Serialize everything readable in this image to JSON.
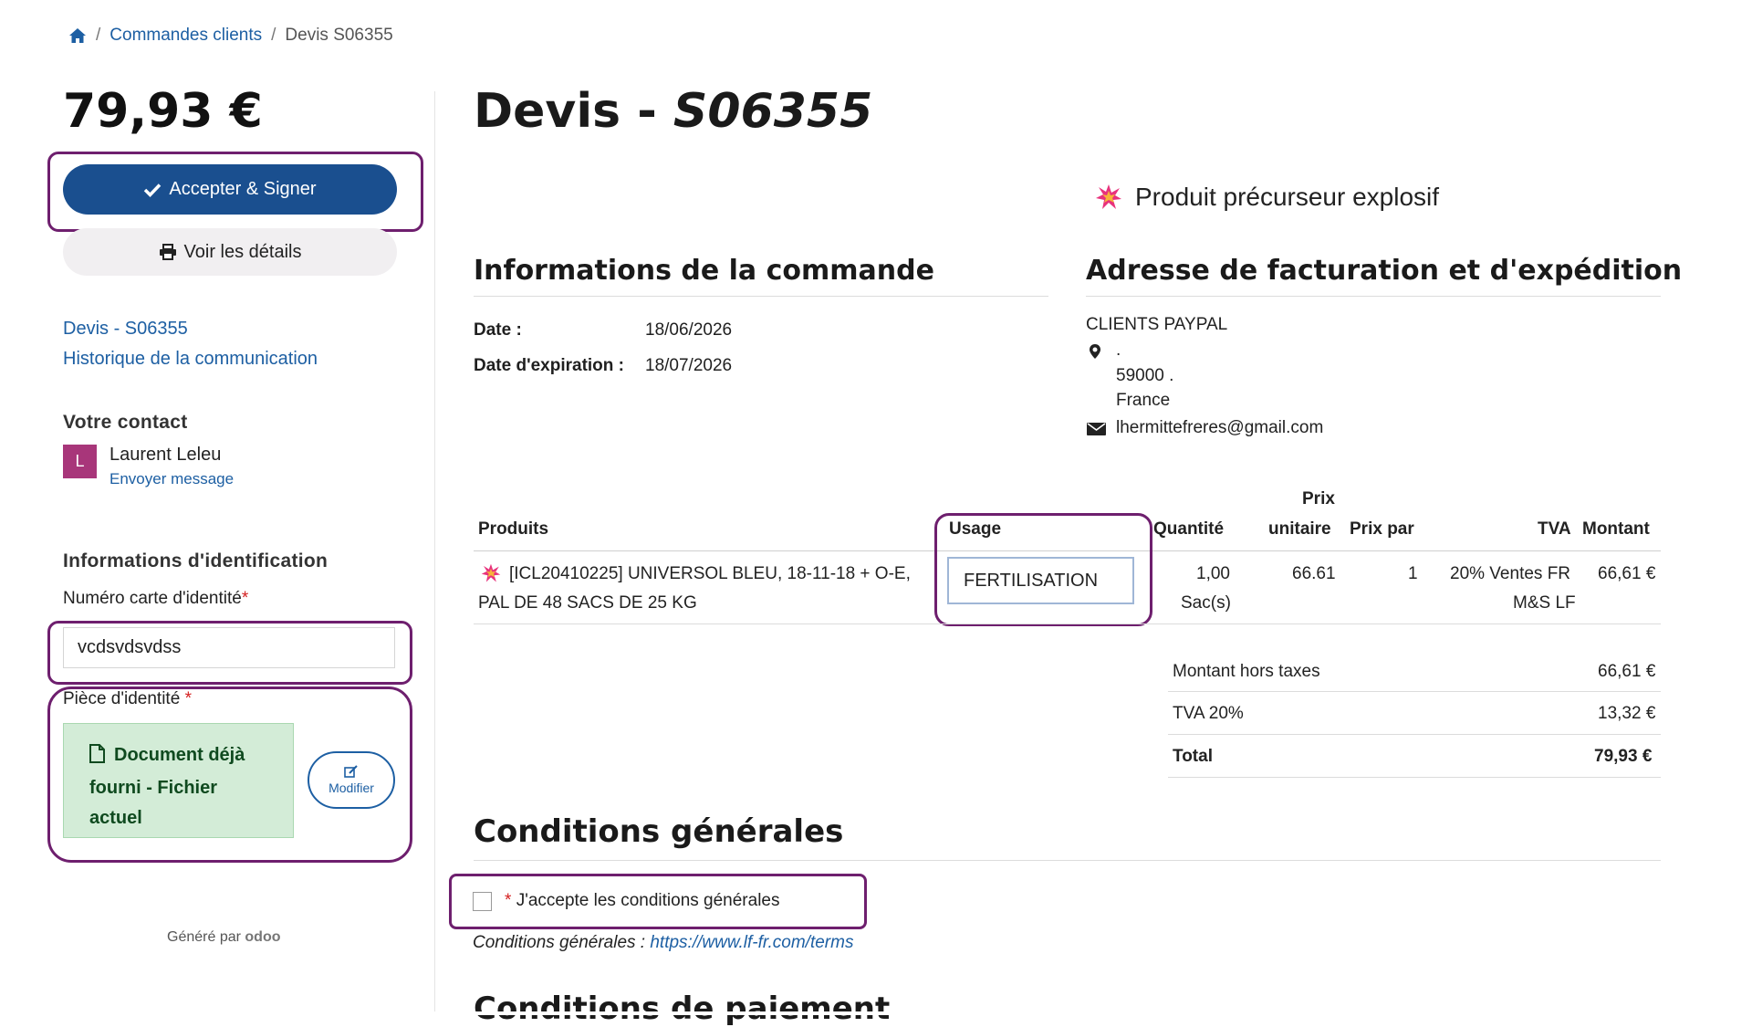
{
  "breadcrumb": {
    "home_icon": "home-icon",
    "sep1": "/",
    "orders": "Commandes clients",
    "sep2": "/",
    "current": "Devis S06355"
  },
  "sidebar": {
    "total": "79,93 €",
    "accept_label": "Accepter & Signer",
    "details_label": "Voir les détails",
    "links": [
      "Devis - S06355",
      "Historique de la communication"
    ],
    "contact_title": "Votre contact",
    "contact_initial": "L",
    "contact_name": "Laurent Leleu",
    "contact_message": "Envoyer message",
    "id_section_title": "Informations d'identification",
    "id_number_label": "Numéro carte d'identité",
    "id_number_value": "vcdsvdsvdss",
    "id_doc_label": "Pièce d'identité",
    "required_mark": "*",
    "doc_status": "Document déjà fourni - Fichier actuel",
    "modify_label": "Modifier",
    "powered_prefix": "Généré par",
    "powered_brand": "odoo",
    "accent": "#1a4f8f",
    "avatar_color": "#a8367a"
  },
  "main": {
    "title_prefix": "Devis - ",
    "title_ref": "S06355",
    "warning": "Produit précurseur explosif",
    "order_info_title": "Informations de la commande",
    "date_label": "Date :",
    "date_value": "18/06/2026",
    "expiry_label": "Date d'expiration :",
    "expiry_value": "18/07/2026",
    "address_title": "Adresse de facturation et d'expédition",
    "customer": "CLIENTS PAYPAL",
    "street": ".",
    "city": "59000 .",
    "country": "France",
    "email": "lhermittefreres@gmail.com"
  },
  "table": {
    "headers": {
      "products": "Produits",
      "usage": "Usage",
      "quantity": "Quantité",
      "unit_price_1": "Prix",
      "unit_price_2": "unitaire",
      "per": "Prix par",
      "tax": "TVA",
      "amount": "Montant"
    },
    "row": {
      "product_line1": "[ICL20410225] UNIVERSOL BLEU, 18-11-18 + O-E,",
      "product_line2": "PAL DE 48 SACS DE 25 KG",
      "usage": "FERTILISATION",
      "qty": "1,00",
      "unit": "Sac(s)",
      "price": "66.61",
      "per": "1",
      "tax_line1": "20% Ventes FR",
      "tax_line2": "M&S LF",
      "amount": "66,61 €"
    },
    "totals": [
      {
        "label": "Montant hors taxes",
        "value": "66,61 €"
      },
      {
        "label": "TVA 20%",
        "value": "13,32 €"
      },
      {
        "label": "Total",
        "value": "79,93 €"
      }
    ]
  },
  "terms": {
    "title": "Conditions générales",
    "required_mark": "*",
    "accept_label": "J'accepte les conditions générales",
    "accepted": false,
    "link_prefix": "Conditions générales :",
    "link": "https://www.lf-fr.com/terms",
    "payment_title": "Conditions de paiement"
  }
}
